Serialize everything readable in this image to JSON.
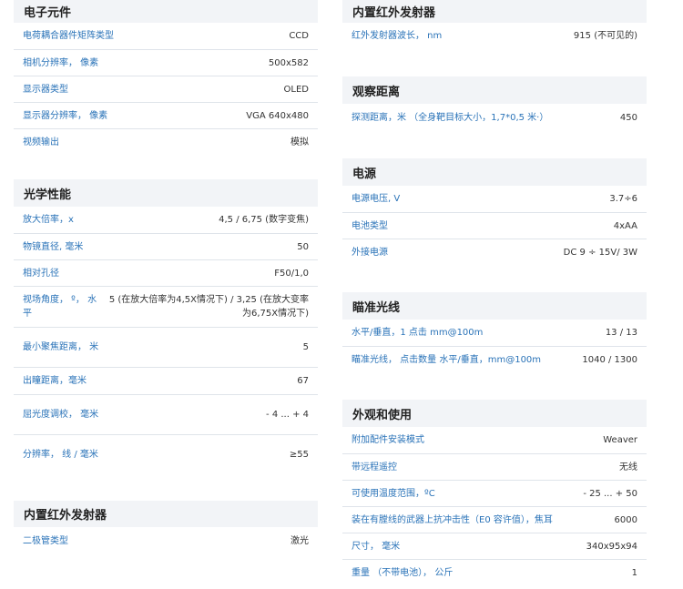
{
  "left": [
    {
      "title": "电子元件",
      "rows": [
        {
          "label": "电荷耦合器件矩阵类型",
          "value": "CCD"
        },
        {
          "label": "相机分辨率， 像素",
          "value": "500x582"
        },
        {
          "label": "显示器类型",
          "value": "OLED"
        },
        {
          "label": "显示器分辨率， 像素",
          "value": "VGA 640x480"
        },
        {
          "label": "视频输出",
          "value": "模拟"
        }
      ]
    },
    {
      "title": "光学性能",
      "rows": [
        {
          "label": "放大倍率，x",
          "value": "4,5 / 6,75 (数字变焦)"
        },
        {
          "label": "物镜直径, 毫米",
          "value": "50"
        },
        {
          "label": "相对孔径",
          "value": "F50/1,0"
        },
        {
          "label": "视场角度， º， 水平",
          "value": "5 (在放大倍率为4,5X情况下) / 3,25 (在放大变率为6,75X情况下)"
        },
        {
          "label": "最小聚焦距离， 米",
          "value": "5"
        },
        {
          "label": "出瞳距离，毫米",
          "value": "67"
        },
        {
          "label": "屈光度调校， 毫米",
          "value": "- 4 ... + 4"
        },
        {
          "label": "分辨率， 线 / 毫米",
          "value": "≥55"
        }
      ]
    },
    {
      "title": "内置红外发射器",
      "rows": [
        {
          "label": "二极管类型",
          "value": "激光"
        }
      ]
    }
  ],
  "right": [
    {
      "title": "内置红外发射器",
      "rows": [
        {
          "label": "红外发射器波长， nm",
          "value": "915 (不可见的)"
        }
      ]
    },
    {
      "title": "观察距离",
      "rows": [
        {
          "label": "探测距离，米 （全身靶目标大小，1,7*0,5 米·）",
          "value": "450"
        }
      ]
    },
    {
      "title": "电源",
      "rows": [
        {
          "label": "电源电压, V",
          "value": "3.7÷6"
        },
        {
          "label": "电池类型",
          "value": "4xAA"
        },
        {
          "label": "外接电源",
          "value": "DC 9 ÷ 15V/ 3W"
        }
      ]
    },
    {
      "title": "瞄准光线",
      "rows": [
        {
          "label": "水平/垂直，1 点击 mm@100m",
          "value": "13 / 13"
        },
        {
          "label": "瞄准光线， 点击数量 水平/垂直，mm@100m",
          "value": "1040 / 1300"
        }
      ]
    },
    {
      "title": "外观和使用",
      "rows": [
        {
          "label": "附加配件安装模式",
          "value": "Weaver"
        },
        {
          "label": "带远程遥控",
          "value": "无线"
        },
        {
          "label": "可使用温度范围，ºC",
          "value": "- 25 ... + 50"
        },
        {
          "label": "装在有膛线的武器上抗冲击性（E0 容许值），焦耳",
          "value": "6000"
        },
        {
          "label": "尺寸， 毫米",
          "value": "340x95x94"
        },
        {
          "label": "重量 （不带电池）， 公斤",
          "value": "1"
        }
      ]
    }
  ]
}
